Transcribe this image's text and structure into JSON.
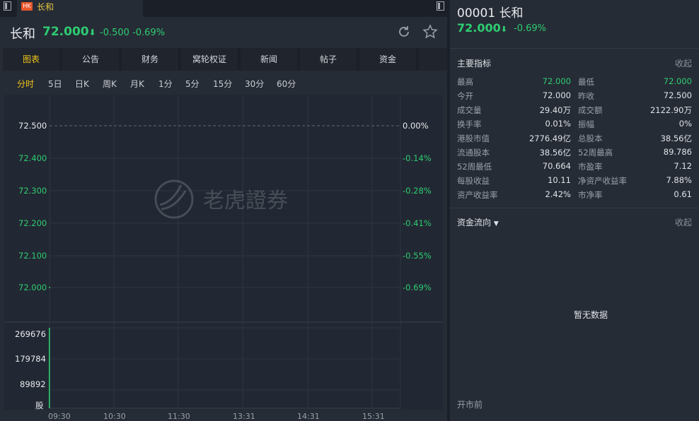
{
  "tab": {
    "badge": "HK",
    "name": "长和"
  },
  "header": {
    "name": "长和",
    "price": "72.000",
    "change": "-0.500",
    "change_pct": "-0.69%"
  },
  "nav_tabs": [
    "图表",
    "公告",
    "财务",
    "窝轮权证",
    "新闻",
    "帖子",
    "资金"
  ],
  "periods": [
    "分时",
    "5日",
    "日K",
    "周K",
    "月K",
    "1分",
    "5分",
    "15分",
    "30分",
    "60分"
  ],
  "chart": {
    "price_ticks": [
      "72.500",
      "72.400",
      "72.300",
      "72.200",
      "72.100",
      "72.000"
    ],
    "pct_ticks": [
      "0.00%",
      "-0.14%",
      "-0.28%",
      "-0.41%",
      "-0.55%",
      "-0.69%"
    ],
    "volume_ticks": [
      "269676",
      "179784",
      "89892"
    ],
    "volume_unit": "股",
    "time_ticks": [
      "09:30",
      "10:30",
      "11:30",
      "13:31",
      "14:31",
      "15:31"
    ],
    "watermark": "老虎證券"
  },
  "chart_data": {
    "type": "line",
    "x": [
      "09:30"
    ],
    "series": [
      {
        "values": [
          72.0
        ]
      }
    ],
    "volume": [
      269676
    ],
    "ylim": [
      72.0,
      72.5
    ],
    "prev_close": 72.5
  },
  "right": {
    "code": "00001",
    "name": "长和",
    "price": "72.000",
    "change_pct": "-0.69%",
    "indicators_title": "主要指标",
    "collapse_label": "收起",
    "indicators": [
      [
        "最高",
        "72.000",
        "最低",
        "72.000"
      ],
      [
        "今开",
        "72.000",
        "昨收",
        "72.500"
      ],
      [
        "成交量",
        "29.40万",
        "成交额",
        "2122.90万"
      ],
      [
        "换手率",
        "0.01%",
        "振幅",
        "0%"
      ],
      [
        "港股市值",
        "2776.49亿",
        "总股本",
        "38.56亿"
      ],
      [
        "流通股本",
        "38.56亿",
        "52周最高",
        "89.786"
      ],
      [
        "52周最低",
        "70.664",
        "市盈率",
        "7.12"
      ],
      [
        "每股收益",
        "10.11",
        "净资产收益率",
        "7.88%"
      ],
      [
        "资产收益率",
        "2.42%",
        "市净率",
        "0.61"
      ]
    ],
    "flow_title": "资金流向",
    "flow_collapse": "收起",
    "no_data": "暂无数据",
    "market_status": "开市前"
  }
}
